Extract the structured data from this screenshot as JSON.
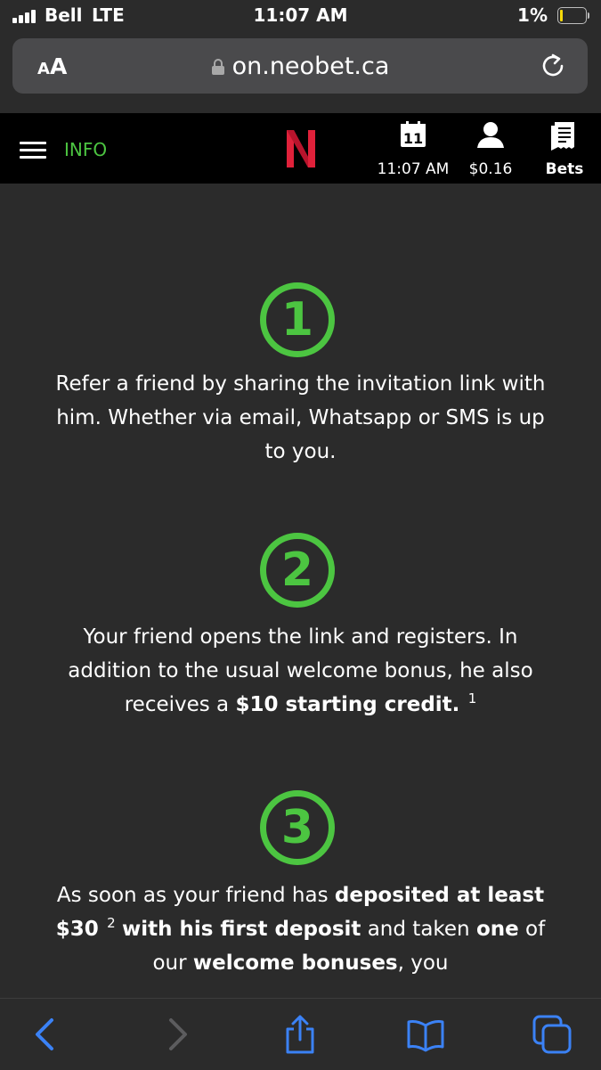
{
  "status_bar": {
    "carrier": "Bell",
    "network": "LTE",
    "time": "11:07 AM",
    "battery_percent": "1%",
    "battery_level": 0.01
  },
  "browser": {
    "text_size_button": {
      "small": "A",
      "big": "A"
    },
    "url": "on.neobet.ca"
  },
  "site_header": {
    "menu_label": "INFO",
    "logo_letter": "N",
    "calendar_day": "11",
    "time": "11:07 AM",
    "balance": "$0.16",
    "bets_label": "Bets"
  },
  "steps": [
    {
      "number": "1",
      "text": "Refer a friend by sharing the invitation link with him. Whether via email, Whatsapp or SMS is up to you."
    },
    {
      "number": "2",
      "text_a": "Your friend opens the link and registers. In addition to the usual welcome bonus, he also receives a ",
      "bold_a": "$10 starting credit.",
      "footnote": "1"
    },
    {
      "number": "3",
      "text_a": "As soon as your friend has ",
      "bold_a": "deposited at least $30",
      "footnote": "2",
      "bold_b": "with his first deposit",
      "text_b": " and taken ",
      "bold_c": "one",
      "text_c": " of our ",
      "bold_d": "welcome bonuses",
      "text_d": ", you"
    }
  ],
  "colors": {
    "accent_green": "#4cc541",
    "logo_red": "#e0213a",
    "ios_blue": "#3b82f6",
    "background": "#2b2b2b"
  },
  "icons": [
    "signal-icon",
    "battery-icon",
    "lock-icon",
    "reload-icon",
    "hamburger-icon",
    "calendar-icon",
    "user-icon",
    "receipt-icon",
    "back-icon",
    "forward-icon",
    "share-icon",
    "bookmarks-icon",
    "tabs-icon"
  ]
}
